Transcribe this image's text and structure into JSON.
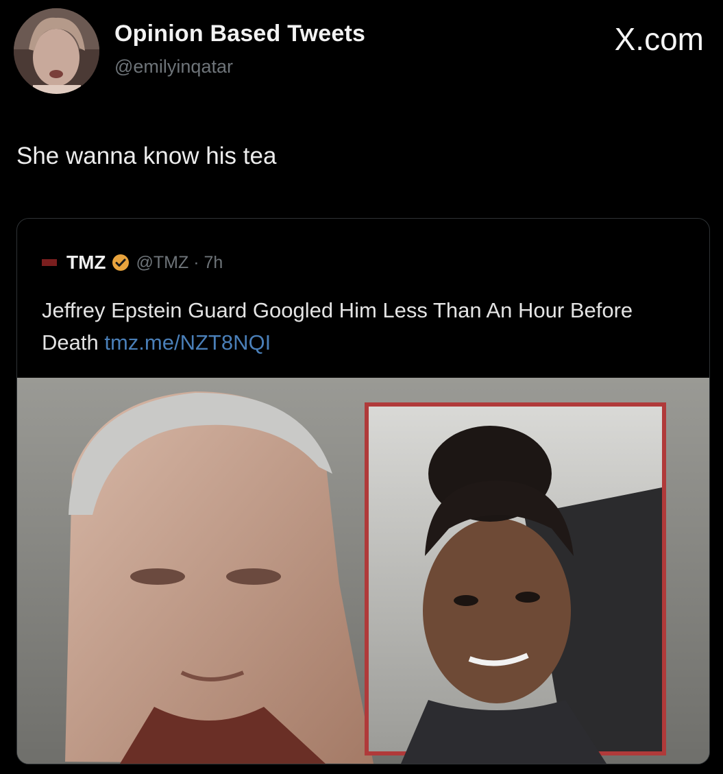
{
  "header": {
    "display_name": "Opinion Based Tweets",
    "handle": "@emilyinqatar",
    "brand": "X.com"
  },
  "tweet": {
    "text": "She wanna know his tea"
  },
  "quote": {
    "name": "TMZ",
    "handle_time": "@TMZ · 7h",
    "text": "Jeffrey Epstein Guard Googled Him Less Than An Hour Before Death",
    "link": "tmz.me/NZT8NQI",
    "verified_color": "#e8a33d"
  },
  "icons": {
    "avatar": "avatar-photo",
    "tmz_logo": "tmz-logo-icon",
    "verified": "verified-badge-icon"
  }
}
